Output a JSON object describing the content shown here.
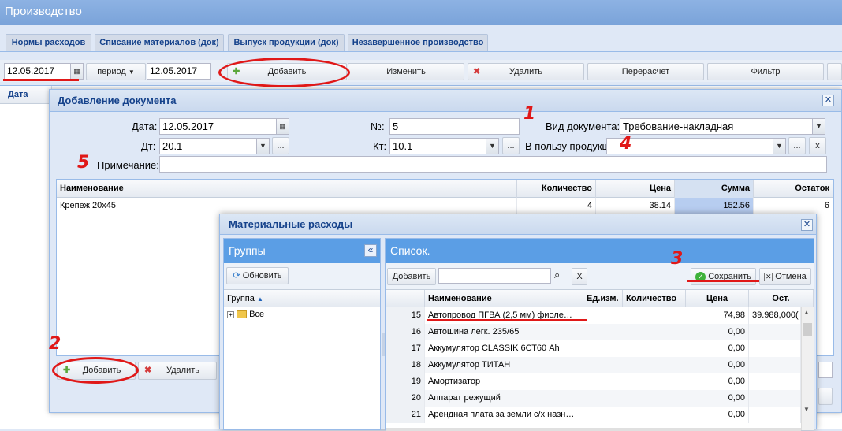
{
  "app": {
    "title": "Производство"
  },
  "tabs": [
    "Нормы расходов",
    "Списание материалов (док)",
    "Выпуск продукции (док)",
    "Незавершенное производство"
  ],
  "toolbar": {
    "date_from": "12.05.2017",
    "period_label": "период",
    "date_to": "12.05.2017",
    "add": "Добавить",
    "edit": "Изменить",
    "delete": "Удалить",
    "recalc": "Перерасчет",
    "filter": "Фильтр"
  },
  "bg_grid": {
    "date_header": "Дата"
  },
  "doc_dialog": {
    "title": "Добавление документа",
    "date_label": "Дата:",
    "date_value": "12.05.2017",
    "num_label": "№:",
    "num_value": "5",
    "doctype_label": "Вид документа:",
    "doctype_value": "Требование-накладная",
    "dt_label": "Дт:",
    "dt_value": "20.1",
    "kt_label": "Кт:",
    "kt_value": "10.1",
    "product_label": "В пользу продукции:",
    "product_value": "",
    "note_label": "Примечание:",
    "note_value": "",
    "ellipsis": "...",
    "x": "x",
    "columns": [
      "Наименование",
      "Количество",
      "Цена",
      "Сумма",
      "Остаток"
    ],
    "rows": [
      {
        "name": "Крепеж 20х45",
        "qty": "4",
        "price": "38.14",
        "sum": "152.56",
        "rest": "6"
      }
    ],
    "add_btn": "Добавить",
    "delete_btn": "Удалить"
  },
  "mat_dialog": {
    "title": "Материальные расходы",
    "groups_title": "Группы",
    "refresh_btn": "Обновить",
    "group_col": "Группа",
    "group_all": "Все",
    "list_title": "Список.",
    "add_btn": "Добавить",
    "search_value": "",
    "clear": "X",
    "save_btn": "Сохранить",
    "cancel_btn": "Отмена",
    "columns": [
      "Наименование",
      "Ед.изм.",
      "Количество",
      "Цена",
      "Ост."
    ],
    "rows": [
      {
        "n": "15",
        "name": "Автопровод ПГВА (2,5 мм) фиоле…",
        "price": "74,98",
        "rest": "39.988,000("
      },
      {
        "n": "16",
        "name": "Автошина легк. 235/65",
        "price": "0,00",
        "rest": ""
      },
      {
        "n": "17",
        "name": "Аккумулятор CLASSIK 6СТ60 Ah",
        "price": "0,00",
        "rest": ""
      },
      {
        "n": "18",
        "name": "Аккумулятор ТИТАН",
        "price": "0,00",
        "rest": ""
      },
      {
        "n": "19",
        "name": "Амортизатор",
        "price": "0,00",
        "rest": ""
      },
      {
        "n": "20",
        "name": "Аппарат режущий",
        "price": "0,00",
        "rest": ""
      },
      {
        "n": "21",
        "name": "Арендная плата за земли с/х назн…",
        "price": "0,00",
        "rest": ""
      }
    ]
  },
  "annotations": [
    "1",
    "2",
    "3",
    "4",
    "5"
  ],
  "colors": {
    "accent": "#5b9ee5",
    "annotation": "#e01818",
    "selected_cell": "#b7cdf0"
  }
}
